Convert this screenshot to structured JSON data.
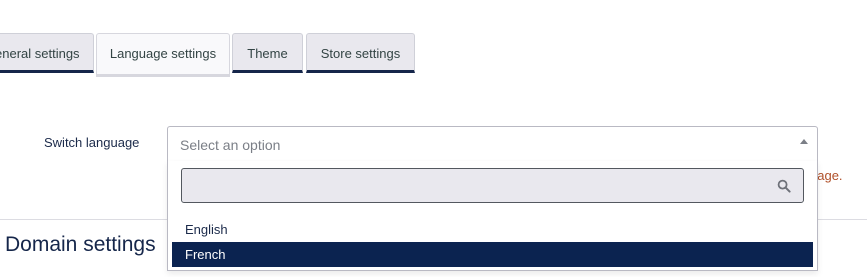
{
  "tabs": [
    {
      "label": "eneral settings",
      "active": false
    },
    {
      "label": "Language settings",
      "active": true
    },
    {
      "label": "Theme",
      "active": false
    },
    {
      "label": "Store settings",
      "active": false
    }
  ],
  "language_form": {
    "label": "Switch language",
    "select": {
      "placeholder": "Select an option",
      "search_placeholder": "",
      "options": [
        {
          "label": "English",
          "highlighted": false
        },
        {
          "label": "French",
          "highlighted": true
        }
      ]
    },
    "help_text_visible": "uage."
  },
  "domain_section": {
    "heading": "Domain settings"
  },
  "colors": {
    "navy": "#15264a",
    "highlight": "#0b2350",
    "help_text": "#b0502a",
    "tab_bg": "#e9e8ee"
  },
  "icons": {
    "search": "search-icon",
    "select_arrow": "triangle-up-icon"
  }
}
